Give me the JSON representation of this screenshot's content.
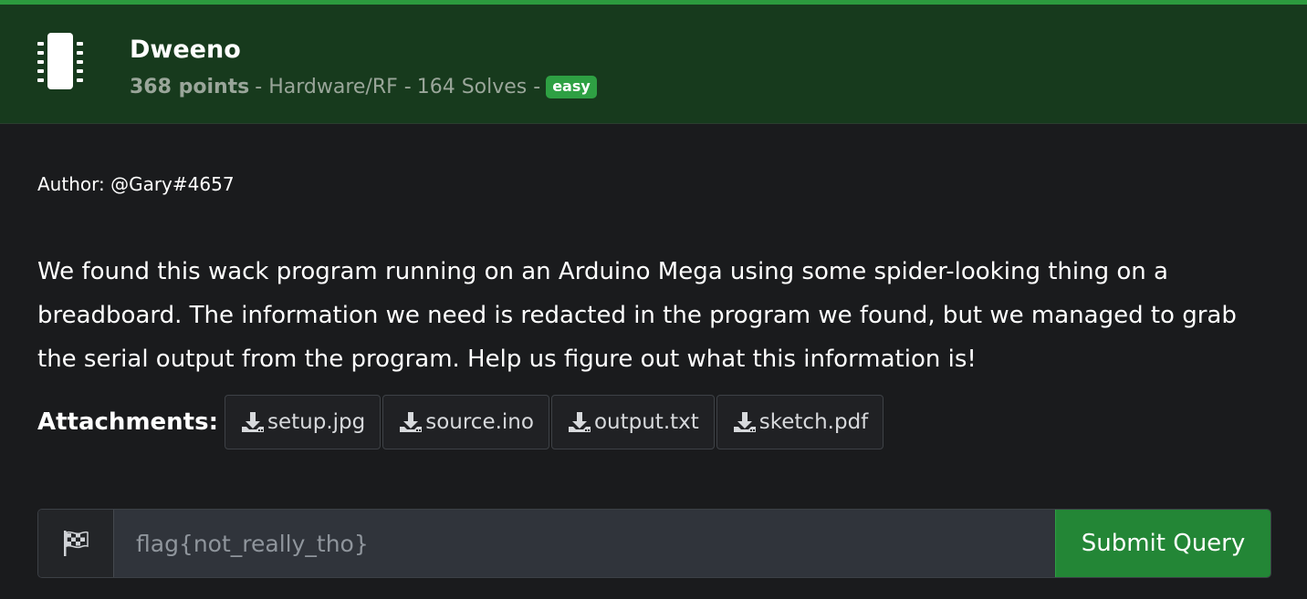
{
  "challenge": {
    "title": "Dweeno",
    "points": "368 points",
    "category": "- Hardware/RF -",
    "solves": "164 Solves -",
    "difficulty": "easy",
    "icon": "chip-icon"
  },
  "author": "Author: @Gary#4657",
  "description": "We found this wack program running on an Arduino Mega using some spider-looking thing on a breadboard. The information we need is redacted in the program we found, but we managed to grab the serial output from the program. Help us figure out what this information is!",
  "attachments": {
    "label": "Attachments:",
    "files": [
      {
        "name": "setup.jpg",
        "icon": "download-icon"
      },
      {
        "name": "source.ino",
        "icon": "download-icon"
      },
      {
        "name": "output.txt",
        "icon": "download-icon"
      },
      {
        "name": "sketch.pdf",
        "icon": "download-icon"
      }
    ]
  },
  "flag_form": {
    "addon_icon": "checkered-flag-icon",
    "placeholder": "flag{not_really_tho}",
    "value": "",
    "submit_label": "Submit Query"
  },
  "colors": {
    "header_bg": "#173a1d",
    "header_accent": "#2c9a3e",
    "badge": "#2ea043",
    "submit": "#238636",
    "body_bg": "#1a1b1d"
  }
}
